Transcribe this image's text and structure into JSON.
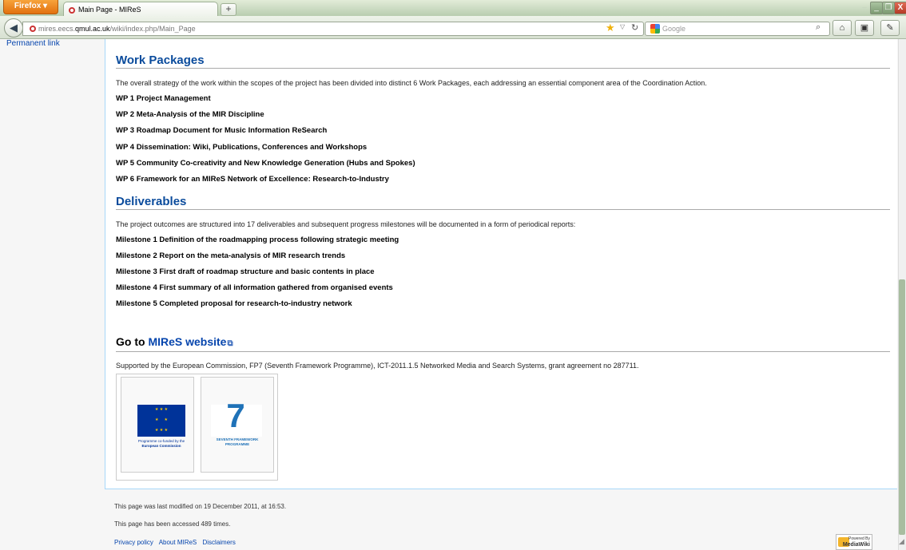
{
  "browser": {
    "firefox_label": "Firefox",
    "tab_title": "Main Page - MIReS",
    "new_tab_label": "+",
    "url_prefix": "mires.eecs.",
    "url_host": "qmul.ac.uk",
    "url_path": "/wiki/index.php/Main_Page",
    "search_placeholder": "Google",
    "window_controls": {
      "minimize": "–",
      "restore": "❐",
      "close": "X"
    }
  },
  "sidebar": {
    "permanent_link": "Permanent link"
  },
  "sections": {
    "work_packages": {
      "heading": "Work Packages",
      "intro": "The overall strategy of the work within the scopes of the project has been divided into distinct 6 Work Packages, each addressing an essential component area of the Coordination Action.",
      "items": [
        "WP 1 Project Management",
        "WP 2 Meta-Analysis of the MIR Discipline",
        "WP 3 Roadmap Document for Music Information ReSearch",
        "WP 4 Dissemination: Wiki, Publications, Conferences and Workshops",
        "WP 5 Community Co-creativity and New Knowledge Generation (Hubs and Spokes)",
        "WP 6 Framework for an MIReS Network of Excellence: Research-to-Industry"
      ]
    },
    "deliverables": {
      "heading": "Deliverables",
      "intro": "The project outcomes are structured into 17 deliverables and subsequent progress milestones will be documented in a form of periodical reports:",
      "items": [
        "Milestone 1 Definition of the roadmapping process following strategic meeting",
        "Milestone 2 Report on the meta-analysis of MIR research trends",
        "Milestone 3 First draft of roadmap structure and basic contents in place",
        "Milestone 4 First summary of all information gathered from organised events",
        "Milestone 5 Completed proposal for research-to-industry network"
      ]
    },
    "goto": {
      "heading_prefix": "Go to",
      "link_text": "MIReS website",
      "supported_by": "Supported by the European Commission, FP7 (Seventh Framework Programme), ICT-2011.1.5 Networked Media and Search Systems, grant agreement no 287711."
    }
  },
  "logos": {
    "eu_caption_line1": "Programme co-funded by the",
    "eu_caption_line2": "European Commission",
    "fp7_caption": "SEVENTH FRAMEWORK PROGRAMME"
  },
  "footer": {
    "last_modified": "This page was last modified on 19 December 2011, at 16:53.",
    "accessed": "This page has been accessed 489 times.",
    "links": [
      "Privacy policy",
      "About MIReS",
      "Disclaimers"
    ],
    "powered_by": "Powered By",
    "mediawiki": "MediaWiki"
  },
  "colors": {
    "heading": "#0a4b9c",
    "link": "#0645ad",
    "content_border": "#a7d7f9",
    "firefox_orange": "#e2700f"
  }
}
